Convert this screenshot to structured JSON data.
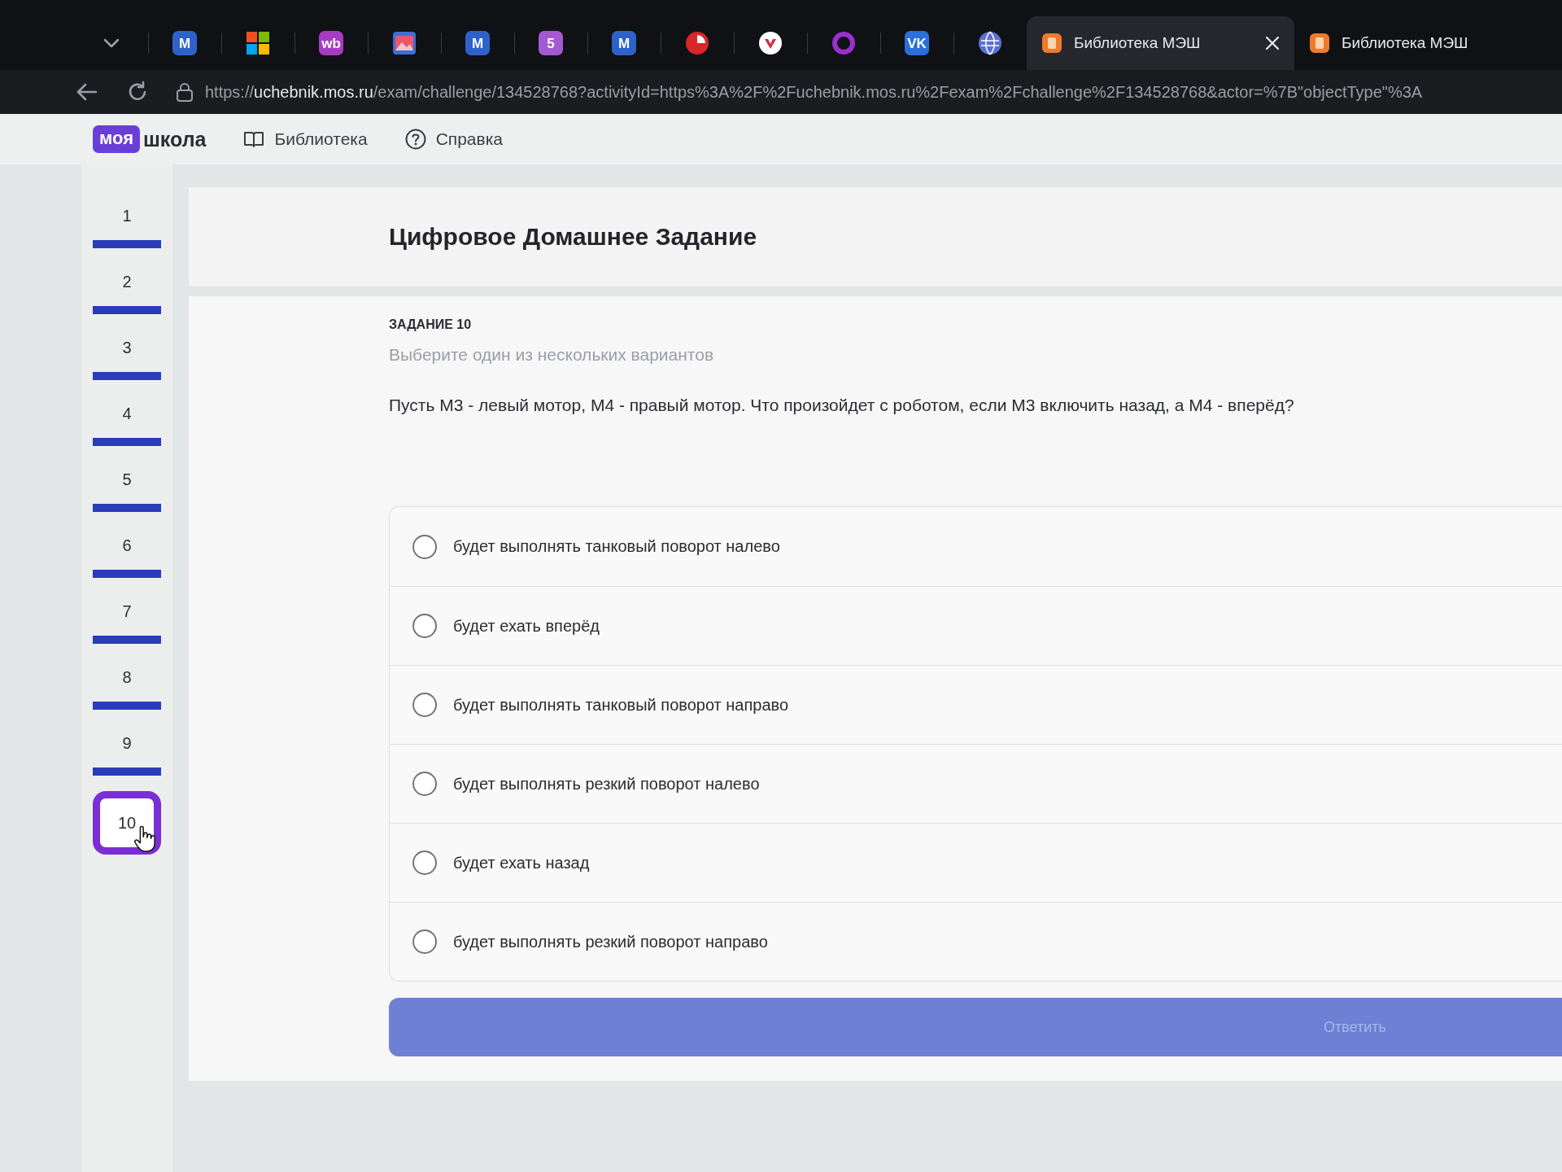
{
  "browser": {
    "pinned_tabs": [
      {
        "kind": "letter",
        "glyph": "M",
        "color": "#2f62c9"
      },
      {
        "kind": "grid"
      },
      {
        "kind": "letter",
        "glyph": "wb",
        "color": "#a83bc4"
      },
      {
        "kind": "picture"
      },
      {
        "kind": "letter",
        "glyph": "M",
        "color": "#2f62c9"
      },
      {
        "kind": "letter",
        "glyph": "5",
        "color": "#a35ad0"
      },
      {
        "kind": "letter",
        "glyph": "M",
        "color": "#2f62c9"
      },
      {
        "kind": "pie",
        "color": "#d8262b"
      },
      {
        "kind": "check",
        "color": "#d22c3a"
      },
      {
        "kind": "ring",
        "color": "#9b2fd0"
      },
      {
        "kind": "letter",
        "glyph": "VK",
        "color": "#2a6fdb"
      },
      {
        "kind": "globe",
        "color": "#5a6fd6"
      }
    ],
    "tabs": [
      {
        "title": "Библиотека МЭШ",
        "selected": true
      },
      {
        "title": "Библиотека МЭШ",
        "selected": false
      }
    ],
    "url": {
      "scheme": "https://",
      "host": "uchebnik.mos.ru",
      "path": "/exam/challenge/134528768?activityId=https%3A%2F%2Fuchebnik.mos.ru%2Fexam%2Fchallenge%2F134528768&actor=%7B\"objectType\"%3A"
    }
  },
  "header": {
    "logo": {
      "badge": "моя",
      "text": "школа"
    },
    "nav": [
      {
        "kind": "library",
        "label": "Библиотека"
      },
      {
        "kind": "help",
        "label": "Справка"
      }
    ]
  },
  "questions": [
    {
      "label": "1",
      "answered": true,
      "selected": false
    },
    {
      "label": "2",
      "answered": true,
      "selected": false
    },
    {
      "label": "3",
      "answered": true,
      "selected": false
    },
    {
      "label": "4",
      "answered": true,
      "selected": false
    },
    {
      "label": "5",
      "answered": true,
      "selected": false
    },
    {
      "label": "6",
      "answered": true,
      "selected": false
    },
    {
      "label": "7",
      "answered": true,
      "selected": false
    },
    {
      "label": "8",
      "answered": true,
      "selected": false
    },
    {
      "label": "9",
      "answered": true,
      "selected": false
    },
    {
      "label": "10",
      "answered": false,
      "selected": true
    }
  ],
  "title": "Цифровое Домашнее Задание",
  "task": {
    "label": "ЗАДАНИЕ 10",
    "hint": "Выберите один из нескольких вариантов",
    "question": "Пусть М3 - левый мотор, М4 - правый мотор. Что произойдет с роботом, если М3 включить назад, а М4 - вперёд?",
    "options": [
      {
        "text": "будет выполнять танковый поворот налево",
        "selected": false
      },
      {
        "text": "будет ехать вперёд",
        "selected": false
      },
      {
        "text": "будет выполнять танковый поворот направо",
        "selected": false
      },
      {
        "text": "будет выполнять резкий поворот налево",
        "selected": false
      },
      {
        "text": "будет ехать назад",
        "selected": false
      },
      {
        "text": "будет выполнять резкий поворот направо",
        "selected": false
      }
    ],
    "submit": {
      "label": "Ответить",
      "disabled": true
    }
  }
}
